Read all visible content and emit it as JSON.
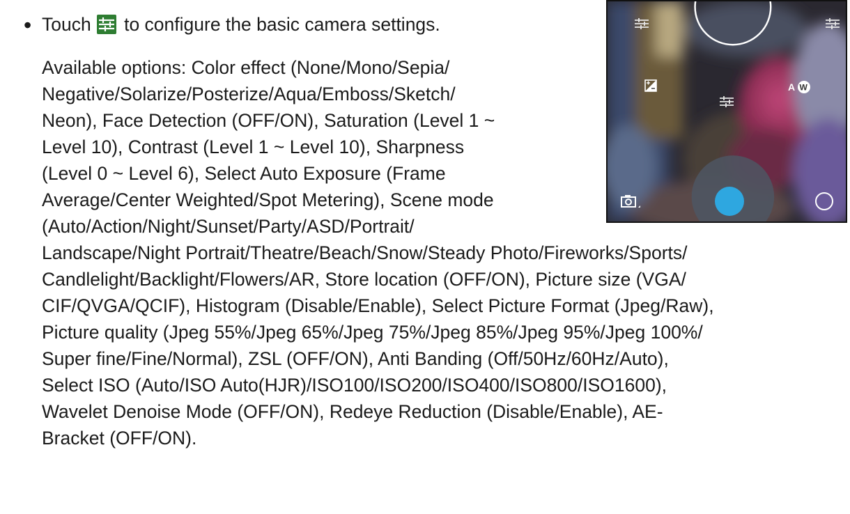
{
  "instructions": {
    "bullet": "•",
    "touch_before": "Touch",
    "touch_after": "to configure the basic camera settings.",
    "settings_icon": "settings-sliders-icon",
    "lines": [
      "Available options: Color effect (None/Mono/Sepia/",
      "Negative/Solarize/Posterize/Aqua/Emboss/Sketch/",
      "Neon), Face Detection (OFF/ON), Saturation (Level 1 ~",
      "Level 10), Contrast (Level 1 ~ Level 10), Sharpness",
      "(Level 0 ~ Level 6), Select Auto Exposure (Frame",
      "Average/Center Weighted/Spot Metering), Scene mode",
      "(Auto/Action/Night/Sunset/Party/ASD/Portrait/",
      "Landscape/Night Portrait/Theatre/Beach/Snow/Steady Photo/Fireworks/Sports/",
      "Candlelight/Backlight/Flowers/AR, Store location (OFF/ON), Picture size (VGA/",
      "CIF/QVGA/QCIF), Histogram (Disable/Enable), Select Picture Format (Jpeg/Raw),",
      "Picture quality (Jpeg 55%/Jpeg 65%/Jpeg 75%/Jpeg 85%/Jpeg 95%/Jpeg 100%/",
      "Super fine/Fine/Normal), ZSL (OFF/ON), Anti Banding (Off/50Hz/60Hz/Auto),",
      "Select ISO (Auto/ISO Auto(HJR)/ISO100/ISO200/ISO400/ISO800/ISO1600),",
      "Wavelet Denoise Mode (OFF/ON), Redeye Reduction (Disable/Enable), AE-",
      "Bracket (OFF/ON)."
    ]
  },
  "camera_screen": {
    "white_balance_label": "AW",
    "shutter_color": "#2ea7e0",
    "accent_green": "#2e7d32"
  }
}
